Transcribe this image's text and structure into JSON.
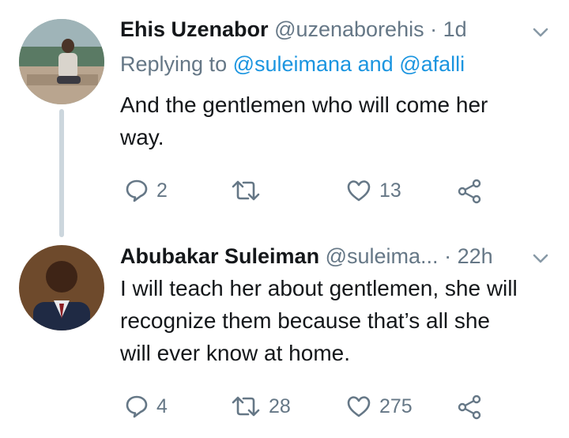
{
  "tweets": [
    {
      "name": "Ehis Uzenabor",
      "handle": "@uzenaborehis",
      "separator": "·",
      "time": "1d",
      "replying_prefix": "Replying to",
      "replying_users": [
        "@suleimana",
        "@afalli"
      ],
      "replying_joiner": "and",
      "text_lines": [
        "And the gentlemen who will come her",
        "way."
      ],
      "replies": "2",
      "retweets": "",
      "likes": "13"
    },
    {
      "name": "Abubakar Suleiman",
      "handle": "@suleima...",
      "separator": "·",
      "time": "22h",
      "text_lines": [
        "I will teach her about gentlemen, she will",
        "recognize them because that’s all she",
        "will ever know at home."
      ],
      "replies": "4",
      "retweets": "28",
      "likes": "275"
    }
  ],
  "icons": {
    "reply": "reply-icon",
    "retweet": "retweet-icon",
    "like": "heart-icon",
    "share": "share-icon",
    "menu": "chevron-down-icon"
  },
  "colors": {
    "name": "#14171a",
    "secondary": "#657786",
    "link": "#1b95e0",
    "thread_line": "#ccd6dd"
  }
}
